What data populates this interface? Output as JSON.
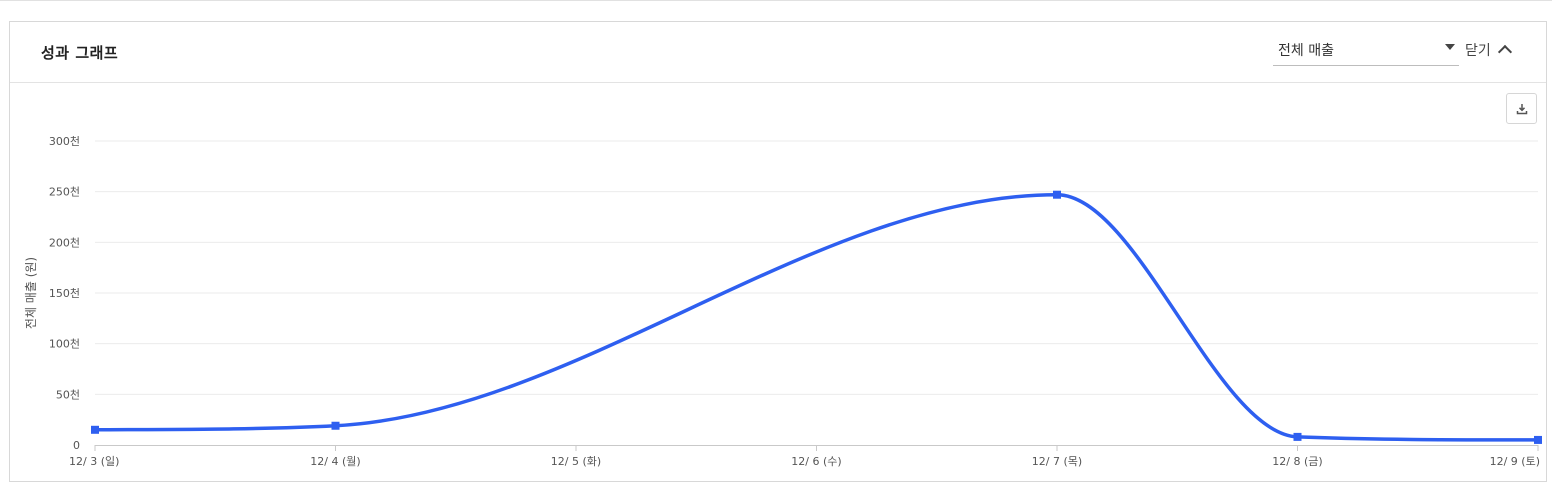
{
  "panel": {
    "title": "성과 그래프",
    "metric_select": {
      "value": "전체 매출"
    },
    "close_toggle": {
      "label": "닫기"
    },
    "download_icon": "download-icon"
  },
  "colors": {
    "line": "#2e5ff0",
    "grid": "#ebebeb",
    "axis_text": "#555555"
  },
  "chart_data": {
    "type": "line",
    "title": "",
    "xlabel": "",
    "ylabel": "전체 매출 (원)",
    "categories": [
      "12/ 3 (일)",
      "12/ 4 (월)",
      "12/ 5 (화)",
      "12/ 6 (수)",
      "12/ 7 (목)",
      "12/ 8 (금)",
      "12/ 9 (토)"
    ],
    "yticks": [
      {
        "value": 0,
        "label": "0"
      },
      {
        "value": 50000,
        "label": "50천"
      },
      {
        "value": 100000,
        "label": "100천"
      },
      {
        "value": 150000,
        "label": "150천"
      },
      {
        "value": 200000,
        "label": "200천"
      },
      {
        "value": 250000,
        "label": "250천"
      },
      {
        "value": 300000,
        "label": "300천"
      }
    ],
    "ylim": [
      0,
      300000
    ],
    "grid": true,
    "series": [
      {
        "points": [
          {
            "x": "12/ 3 (일)",
            "y": 15000
          },
          {
            "x": "12/ 4 (월)",
            "y": 19000
          },
          {
            "x": "12/ 7 (목)",
            "y": 247000
          },
          {
            "x": "12/ 8 (금)",
            "y": 8000
          },
          {
            "x": "12/ 9 (토)",
            "y": 5000
          }
        ]
      }
    ]
  }
}
